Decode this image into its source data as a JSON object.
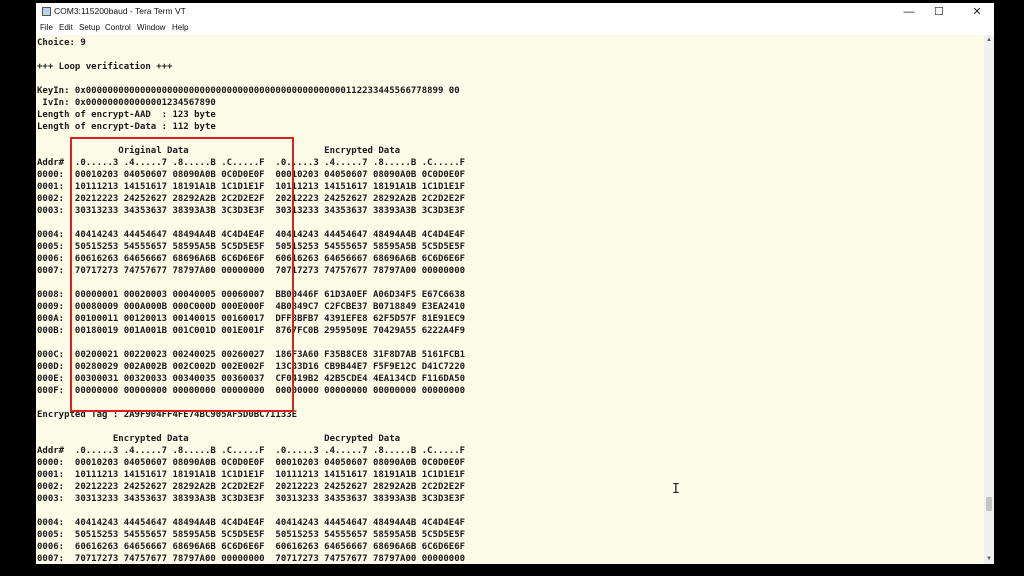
{
  "window": {
    "title": "COM3:115200baud - Tera Term VT",
    "controls": {
      "minimize": "—",
      "maximize": "☐",
      "close": "✕"
    },
    "app_icon": "terminal-app-icon"
  },
  "menubar": {
    "items": [
      "File",
      "Edit",
      "Setup",
      "Control",
      "Window",
      "Help"
    ]
  },
  "terminal": {
    "lines": [
      "Choice: 9",
      "",
      "+++ Loop verification +++",
      "",
      "KeyIn: 0x000000000000000000000000000000000000000000000000112233445566778899 00",
      " IvIn: 0x000000000000001234567890",
      "Length of encrypt-AAD  : 123 byte",
      "Length of encrypt-Data : 112 byte",
      "",
      "               Original Data                         Encrypted Data",
      "Addr#  .0.....3 .4.....7 .8.....B .C.....F  .0.....3 .4.....7 .8.....B .C.....F",
      "0000:  00010203 04050607 08090A0B 0C0D0E0F  00010203 04050607 08090A0B 0C0D0E0F",
      "0001:  10111213 14151617 18191A1B 1C1D1E1F  10111213 14151617 18191A1B 1C1D1E1F",
      "0002:  20212223 24252627 28292A2B 2C2D2E2F  20212223 24252627 28292A2B 2C2D2E2F",
      "0003:  30313233 34353637 38393A3B 3C3D3E3F  30313233 34353637 38393A3B 3C3D3E3F",
      "",
      "0004:  40414243 44454647 48494A4B 4C4D4E4F  40414243 44454647 48494A4B 4C4D4E4F",
      "0005:  50515253 54555657 58595A5B 5C5D5E5F  50515253 54555657 58595A5B 5C5D5E5F",
      "0006:  60616263 64656667 68696A6B 6C6D6E6F  60616263 64656667 68696A6B 6C6D6E6F",
      "0007:  70717273 74757677 78797A00 00000000  70717273 74757677 78797A00 00000000",
      "",
      "0008:  00000001 00020003 00040005 00060007  BB00446F 61D3A0EF A06D34F5 E67C6638",
      "0009:  00080009 000A000B 000C000D 000E000F  4B0849C7 C2FCBE37 B0718849 E3EA2410",
      "000A:  00100011 00120013 00140015 00160017  DFF8BFB7 4391EFE8 62F5D57F 81E91EC9",
      "000B:  00180019 001A001B 001C001D 001E001F  8767FC0B 2959509E 70429A55 6222A4F9",
      "",
      "000C:  00200021 00220023 00240025 00260027  186F3A60 F35B8CE8 31F8D7AB 5161FCB1",
      "000D:  00280029 002A002B 002C002D 002E002F  13C33D16 CB9B44E7 F5F9E12C D41C7220",
      "000E:  00300031 00320033 00340035 00360037  CF0419B2 42B5CDE4 4EA134CD F116DA50",
      "000F:  00000000 00000000 00000000 00000000  00000000 00000000 00000000 00000000",
      "",
      "Encrypted Tag : 2A9F904FF4FE74BC905AF5D0BC71133E",
      "",
      "              Encrypted Data                         Decrypted Data",
      "Addr#  .0.....3 .4.....7 .8.....B .C.....F  .0.....3 .4.....7 .8.....B .C.....F",
      "0000:  00010203 04050607 08090A0B 0C0D0E0F  00010203 04050607 08090A0B 0C0D0E0F",
      "0001:  10111213 14151617 18191A1B 1C1D1E1F  10111213 14151617 18191A1B 1C1D1E1F",
      "0002:  20212223 24252627 28292A2B 2C2D2E2F  20212223 24252627 28292A2B 2C2D2E2F",
      "0003:  30313233 34353637 38393A3B 3C3D3E3F  30313233 34353637 38393A3B 3C3D3E3F",
      "",
      "0004:  40414243 44454647 48494A4B 4C4D4E4F  40414243 44454647 48494A4B 4C4D4E4F",
      "0005:  50515253 54555657 58595A5B 5C5D5E5F  50515253 54555657 58595A5B 5C5D5E5F",
      "0006:  60616263 64656667 68696A6B 6C6D6E6F  60616263 64656667 68696A6B 6C6D6E6F",
      "0007:  70717273 74757677 78797A00 00000000  70717273 74757677 78797A00 00000000"
    ],
    "highlight_color": "#e0201a",
    "background_color": "#fdfce8",
    "text_color": "#1a1a1a"
  },
  "cursor": {
    "glyph": "I",
    "icon": "text-cursor-icon"
  }
}
